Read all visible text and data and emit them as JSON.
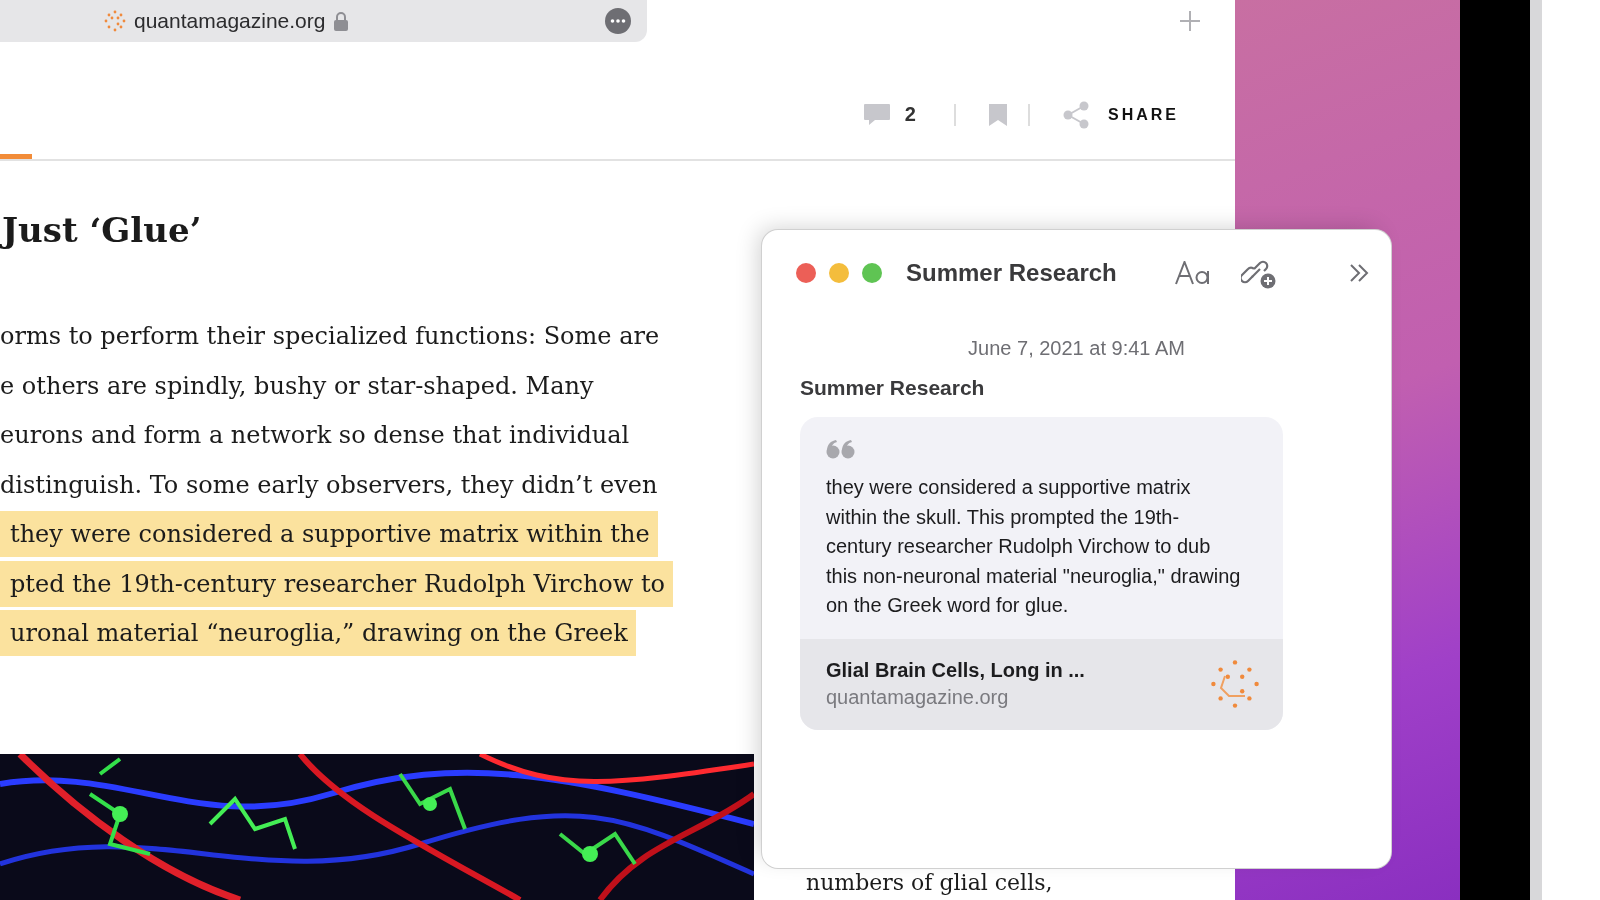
{
  "browser": {
    "address": {
      "url": "quantamagazine.org",
      "secure": true
    }
  },
  "article_toolbar": {
    "comment_count": "2",
    "share_label": "SHARE"
  },
  "reading_progress": {
    "level": 0.026
  },
  "article": {
    "heading": "Just ‘Glue’",
    "lines": [
      {
        "text": "orms to perform their specialized functions: Some are",
        "highlighted": false
      },
      {
        "text": "e others are spindly, bushy or star-shaped. Many",
        "highlighted": false
      },
      {
        "text": "eurons and form a network so dense that individual",
        "highlighted": false
      },
      {
        "text": "distinguish. To some early observers, they didn’t even",
        "highlighted": false
      },
      {
        "text": "they were considered a supportive matrix within the",
        "highlighted": true
      },
      {
        "text": "pted the 19th-century researcher Rudolph Virchow to",
        "highlighted": true
      },
      {
        "text": "uronal material “neuroglia,” drawing on the Greek",
        "highlighted": true
      }
    ],
    "continuation": "numbers of glial cells,"
  },
  "note_window": {
    "title": "Summer Research",
    "date": "June 7, 2021 at 9:41 AM",
    "heading": "Summer Research",
    "quote": "they were considered a supportive matrix within the skull. This prompted the 19th-century researcher Rudolph Virchow to dub this non-neuronal material \"neuroglia,\" drawing on the Greek word for glue.",
    "link": {
      "title": "Glial Brain Cells, Long in ...",
      "domain": "quantamagazine.org"
    }
  }
}
